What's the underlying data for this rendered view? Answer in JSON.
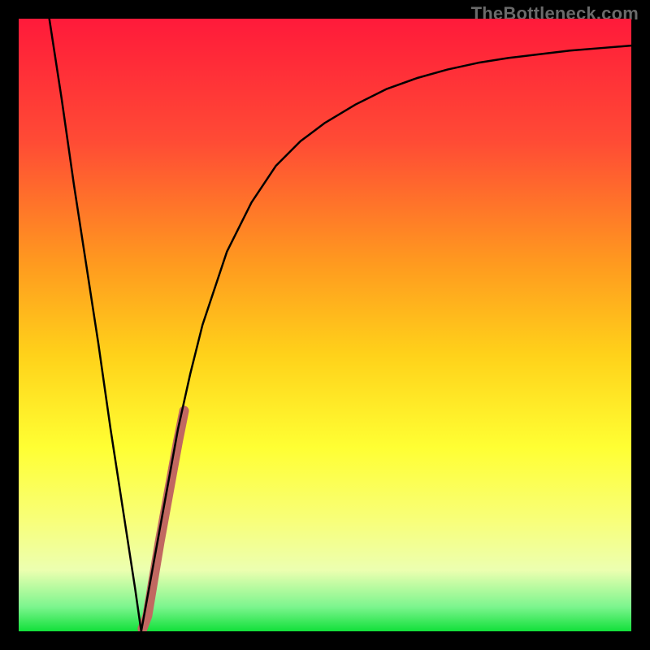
{
  "watermark": "TheBottleneck.com",
  "chart_data": {
    "type": "line",
    "title": "",
    "xlabel": "",
    "ylabel": "",
    "xlim": [
      0,
      100
    ],
    "ylim": [
      0,
      100
    ],
    "grid": false,
    "legend": false,
    "series": [
      {
        "name": "bottleneck-curve",
        "color": "#000000",
        "stroke_width": 2.5,
        "x": [
          5,
          7,
          9,
          11,
          13,
          15,
          17,
          19,
          20,
          22,
          24,
          26,
          28,
          30,
          34,
          38,
          42,
          46,
          50,
          55,
          60,
          65,
          70,
          75,
          80,
          85,
          90,
          95,
          100
        ],
        "y": [
          100,
          87,
          73,
          60,
          47,
          33,
          20,
          7,
          0,
          11,
          22,
          33,
          42,
          50,
          62,
          70,
          76,
          80,
          83,
          86,
          88.5,
          90.3,
          91.7,
          92.8,
          93.6,
          94.2,
          94.8,
          95.2,
          95.6
        ]
      },
      {
        "name": "highlight-segment",
        "color": "#c16861",
        "stroke_width": 12,
        "x": [
          20.2,
          21.0,
          22.0,
          23.0,
          24.0,
          25.0,
          26.0,
          27.0
        ],
        "y": [
          0.4,
          2.5,
          8.5,
          14.5,
          20.0,
          25.5,
          31.0,
          36.0
        ]
      }
    ],
    "background_gradient": {
      "stops": [
        {
          "pos": 0.0,
          "color": "#ff1a3a"
        },
        {
          "pos": 0.2,
          "color": "#ff4b35"
        },
        {
          "pos": 0.4,
          "color": "#ff9a1f"
        },
        {
          "pos": 0.55,
          "color": "#ffd21a"
        },
        {
          "pos": 0.7,
          "color": "#ffff33"
        },
        {
          "pos": 0.82,
          "color": "#f8ff7a"
        },
        {
          "pos": 0.9,
          "color": "#ecffb0"
        },
        {
          "pos": 0.96,
          "color": "#7cf58e"
        },
        {
          "pos": 1.0,
          "color": "#12e03a"
        }
      ]
    }
  }
}
